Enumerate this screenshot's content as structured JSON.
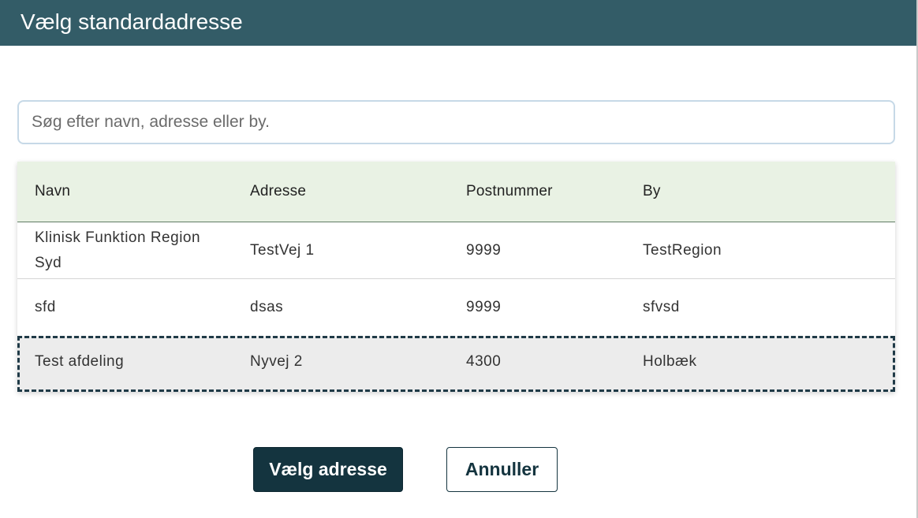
{
  "dialog": {
    "title": "Vælg standardadresse"
  },
  "search": {
    "placeholder": "Søg efter navn, adresse eller by.",
    "value": ""
  },
  "table": {
    "columns": [
      "Navn",
      "Adresse",
      "Postnummer",
      "By"
    ],
    "rows": [
      {
        "navn": "Klinisk Funktion Region Syd",
        "adresse": "TestVej 1",
        "postnummer": "9999",
        "by": "TestRegion"
      },
      {
        "navn": "sfd",
        "adresse": "dsas",
        "postnummer": "9999",
        "by": "sfvsd"
      },
      {
        "navn": "Test afdeling",
        "adresse": "Nyvej 2",
        "postnummer": "4300",
        "by": "Holbæk"
      }
    ],
    "focused_row": 2
  },
  "buttons": {
    "select_label": "Vælg adresse",
    "cancel_label": "Annuller"
  },
  "colors": {
    "header_bg": "#335c67",
    "table_header_bg": "#e9f2e4",
    "primary_button_bg": "#14343f",
    "focused_row_bg": "#ececec"
  }
}
